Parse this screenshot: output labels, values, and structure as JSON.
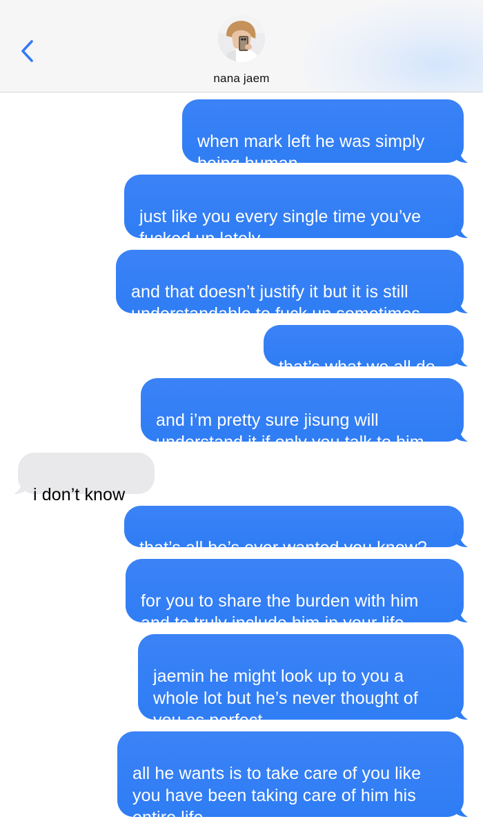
{
  "header": {
    "contact_name": "nana jaem",
    "back_icon": "chevron-left-icon",
    "avatar": "contact-avatar-photo"
  },
  "colors": {
    "sent_bubble": "#3b82f6",
    "received_bubble": "#e9e9eb",
    "accent": "#3478f6",
    "header_bg": "#f6f6f7"
  },
  "messages": [
    {
      "from": "me",
      "text": "when mark left he was simply\nbeing human"
    },
    {
      "from": "me",
      "text": "just like you every single time you’ve\nfucked up lately"
    },
    {
      "from": "me",
      "text": "and that doesn’t justify it but it is still\nunderstandable to fuck up sometimes"
    },
    {
      "from": "me",
      "text": "that’s what we all do"
    },
    {
      "from": "me",
      "text": "and i’m pretty sure jisung will\nunderstand it if only you talk to him"
    },
    {
      "from": "them",
      "text": "i don’t know"
    },
    {
      "from": "me",
      "text": "that’s all he’s ever wanted you know?"
    },
    {
      "from": "me",
      "text": "for you to share the burden with him\nand to truly include him in your life"
    },
    {
      "from": "me",
      "text": "jaemin he might look up to you a\nwhole lot but he’s never thought of\nyou as perfect"
    },
    {
      "from": "me",
      "text": "all he wants is to take care of you like\nyou have been taking care of him his\nentire life"
    }
  ]
}
